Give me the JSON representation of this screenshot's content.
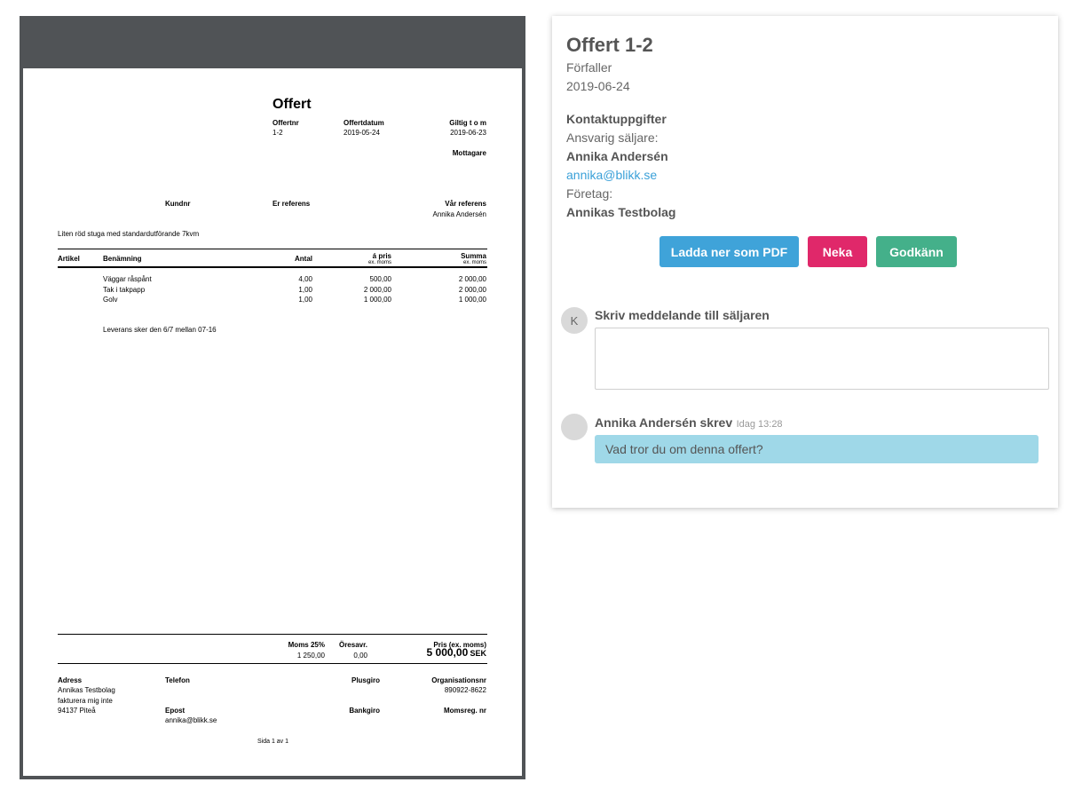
{
  "pdf": {
    "title": "Offert",
    "meta": {
      "nr_label": "Offertnr",
      "nr": "1-2",
      "date_label": "Offertdatum",
      "date": "2019-05-24",
      "valid_label": "Giltig t o m",
      "valid": "2019-06-23"
    },
    "recipient_label": "Mottagare",
    "ref": {
      "customer_label": "Kundnr",
      "your_ref_label": "Er referens",
      "our_ref_label": "Vår referens",
      "our_ref": "Annika Andersén"
    },
    "description": "Liten röd stuga med standardutförande 7kvm",
    "columns": {
      "article": "Artikel",
      "name": "Benämning",
      "qty": "Antal",
      "price": "á pris",
      "price_sub": "ex. moms",
      "sum": "Summa",
      "sum_sub": "ex. moms"
    },
    "rows": [
      {
        "name": "Väggar råspånt",
        "qty": "4,00",
        "price": "500,00",
        "sum": "2 000,00"
      },
      {
        "name": "Tak i takpapp",
        "qty": "1,00",
        "price": "2 000,00",
        "sum": "2 000,00"
      },
      {
        "name": "Golv",
        "qty": "1,00",
        "price": "1 000,00",
        "sum": "1 000,00"
      }
    ],
    "note": "Leverans sker den 6/7 mellan 07-16",
    "totals": {
      "vat_label": "Moms 25%",
      "vat": "1 250,00",
      "round_label": "Öresavr.",
      "round": "0,00",
      "price_label": "Pris (ex. moms)",
      "price": "5 000,00",
      "currency": "SEK"
    },
    "footer": {
      "address_label": "Adress",
      "address_lines": [
        "Annikas Testbolag",
        "fakturera mig inte",
        "94137 Piteå"
      ],
      "phone_label": "Telefon",
      "email_label": "Epost",
      "email": "annika@blikk.se",
      "plusgiro_label": "Plusgiro",
      "bankgiro_label": "Bankgiro",
      "org_label": "Organisationsnr",
      "org": "890922-8622",
      "vatreg_label": "Momsreg. nr"
    },
    "page_label": "Sida 1 av 1"
  },
  "card": {
    "title": "Offert 1-2",
    "due_label": "Förfaller",
    "due_date": "2019-06-24",
    "contact_heading": "Kontaktuppgifter",
    "seller_label": "Ansvarig säljare:",
    "seller_name": "Annika Andersén",
    "seller_email": "annika@blikk.se",
    "company_label": "Företag:",
    "company_name": "Annikas Testbolag",
    "buttons": {
      "pdf": "Ladda ner som PDF",
      "reject": "Neka",
      "approve": "Godkänn"
    },
    "colors": {
      "pdf": "#3fa3d9",
      "reject": "#e0286a",
      "approve": "#44b08a"
    },
    "compose": {
      "avatar_initial": "K",
      "label": "Skriv meddelande till säljaren",
      "value": ""
    },
    "message": {
      "author": "Annika Andersén skrev",
      "time": "Idag 13:28",
      "text": "Vad tror du om denna offert?"
    }
  }
}
